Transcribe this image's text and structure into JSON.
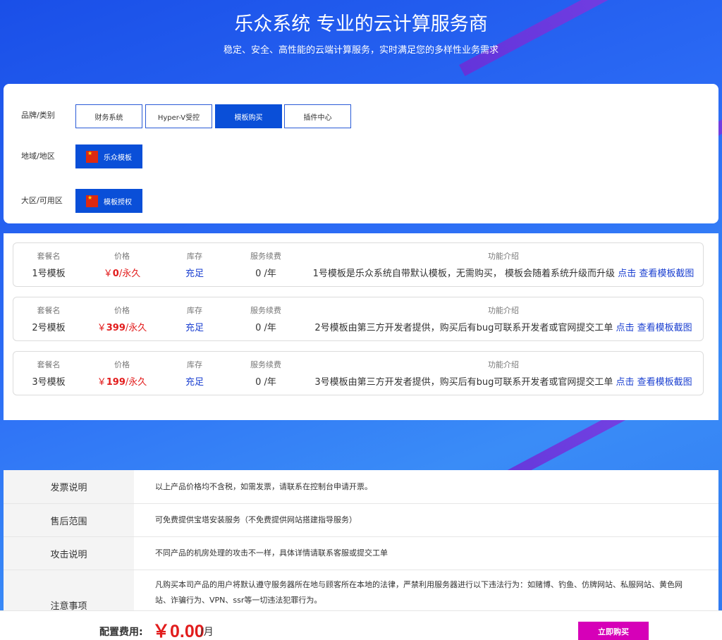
{
  "hero": {
    "title": "乐众系统 专业的云计算服务商",
    "subtitle": "稳定、安全、高性能的云端计算服务，实时满足您的多样性业务需求"
  },
  "filters": {
    "brand_label": "品牌/类别",
    "brand_options": [
      "财务系统",
      "Hyper-V受控",
      "模板购买",
      "插件中心"
    ],
    "brand_selected": "模板购买",
    "region_label": "地域/地区",
    "region_option": "乐众模板",
    "zone_label": "大区/可用区",
    "zone_option": "模板授权"
  },
  "products": {
    "headers": {
      "name": "套餐名",
      "price": "价格",
      "stock": "库存",
      "renewal": "服务续费",
      "feature": "功能介绍"
    },
    "items": [
      {
        "name": "1号模板",
        "price_symbol": "￥",
        "price_value": "0",
        "price_suffix": "/永久",
        "stock": "充足",
        "renewal": "0 /年",
        "feature": "1号模板是乐众系统自带默认模板，无需购买， 模板会随着系统升级而升级",
        "link1": "点击",
        "link2": "查看模板截图"
      },
      {
        "name": "2号模板",
        "price_symbol": "￥",
        "price_value": "399",
        "price_suffix": "/永久",
        "stock": "充足",
        "renewal": "0 /年",
        "feature": "2号模板由第三方开发者提供，购买后有bug可联系开发者或官网提交工单",
        "link1": "点击",
        "link2": "查看模板截图"
      },
      {
        "name": "3号模板",
        "price_symbol": "￥",
        "price_value": "199",
        "price_suffix": "/永久",
        "stock": "充足",
        "renewal": "0 /年",
        "feature": "3号模板由第三方开发者提供，购买后有bug可联系开发者或官网提交工单",
        "link1": "点击",
        "link2": "查看模板截图"
      }
    ]
  },
  "info": [
    {
      "key": "发票说明",
      "value": "以上产品价格均不含税，如需发票，请联系在控制台申请开票。"
    },
    {
      "key": "售后范围",
      "value": "可免费提供宝塔安装服务（不免费提供网站搭建指导服务）"
    },
    {
      "key": "攻击说明",
      "value": "不同产品的机房处理的攻击不一样，具体详情请联系客服或提交工单"
    },
    {
      "key": "注意事项",
      "value": "凡购买本司产品的用户将默认遵守服务器所在地与顾客所在本地的法律，严禁利用服务器进行以下违法行为：如赌博、钓鱼、仿牌网站、私服网站、黄色网站、诈骗行为、VPN、ssr等一切违法犯罪行为。"
    }
  ],
  "footer": {
    "cost_label": "配置费用:",
    "cost_amount": "￥0.00",
    "cost_unit": "/月",
    "buy_label": "立即购买"
  },
  "colors": {
    "accent": "#0a4fd8",
    "price": "#e21d1d",
    "buy": "#d600b8"
  }
}
